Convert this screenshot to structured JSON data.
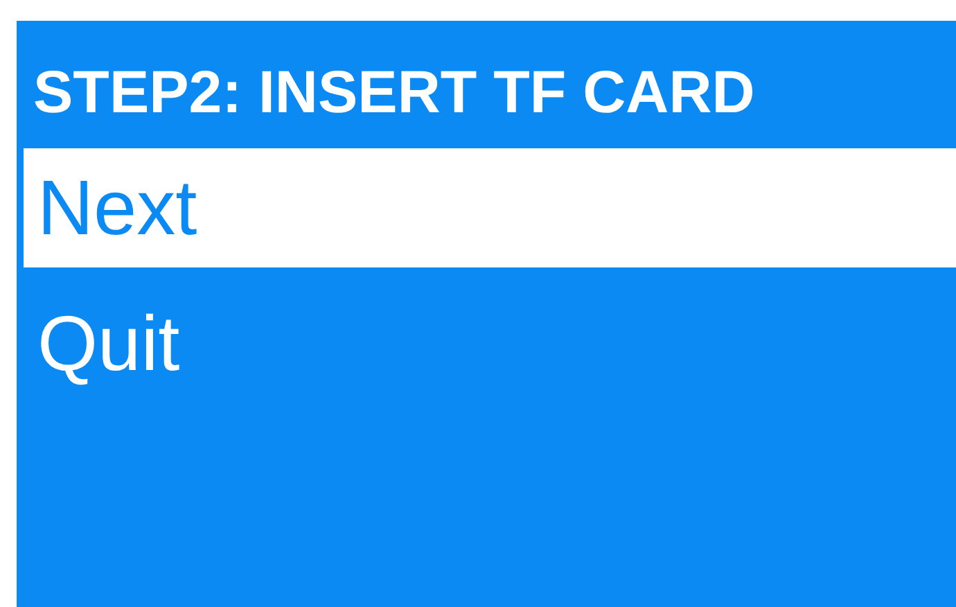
{
  "title": "STEP2: INSERT TF CARD",
  "menu": [
    {
      "label": "Next",
      "selected": true
    },
    {
      "label": "Quit",
      "selected": false
    }
  ]
}
